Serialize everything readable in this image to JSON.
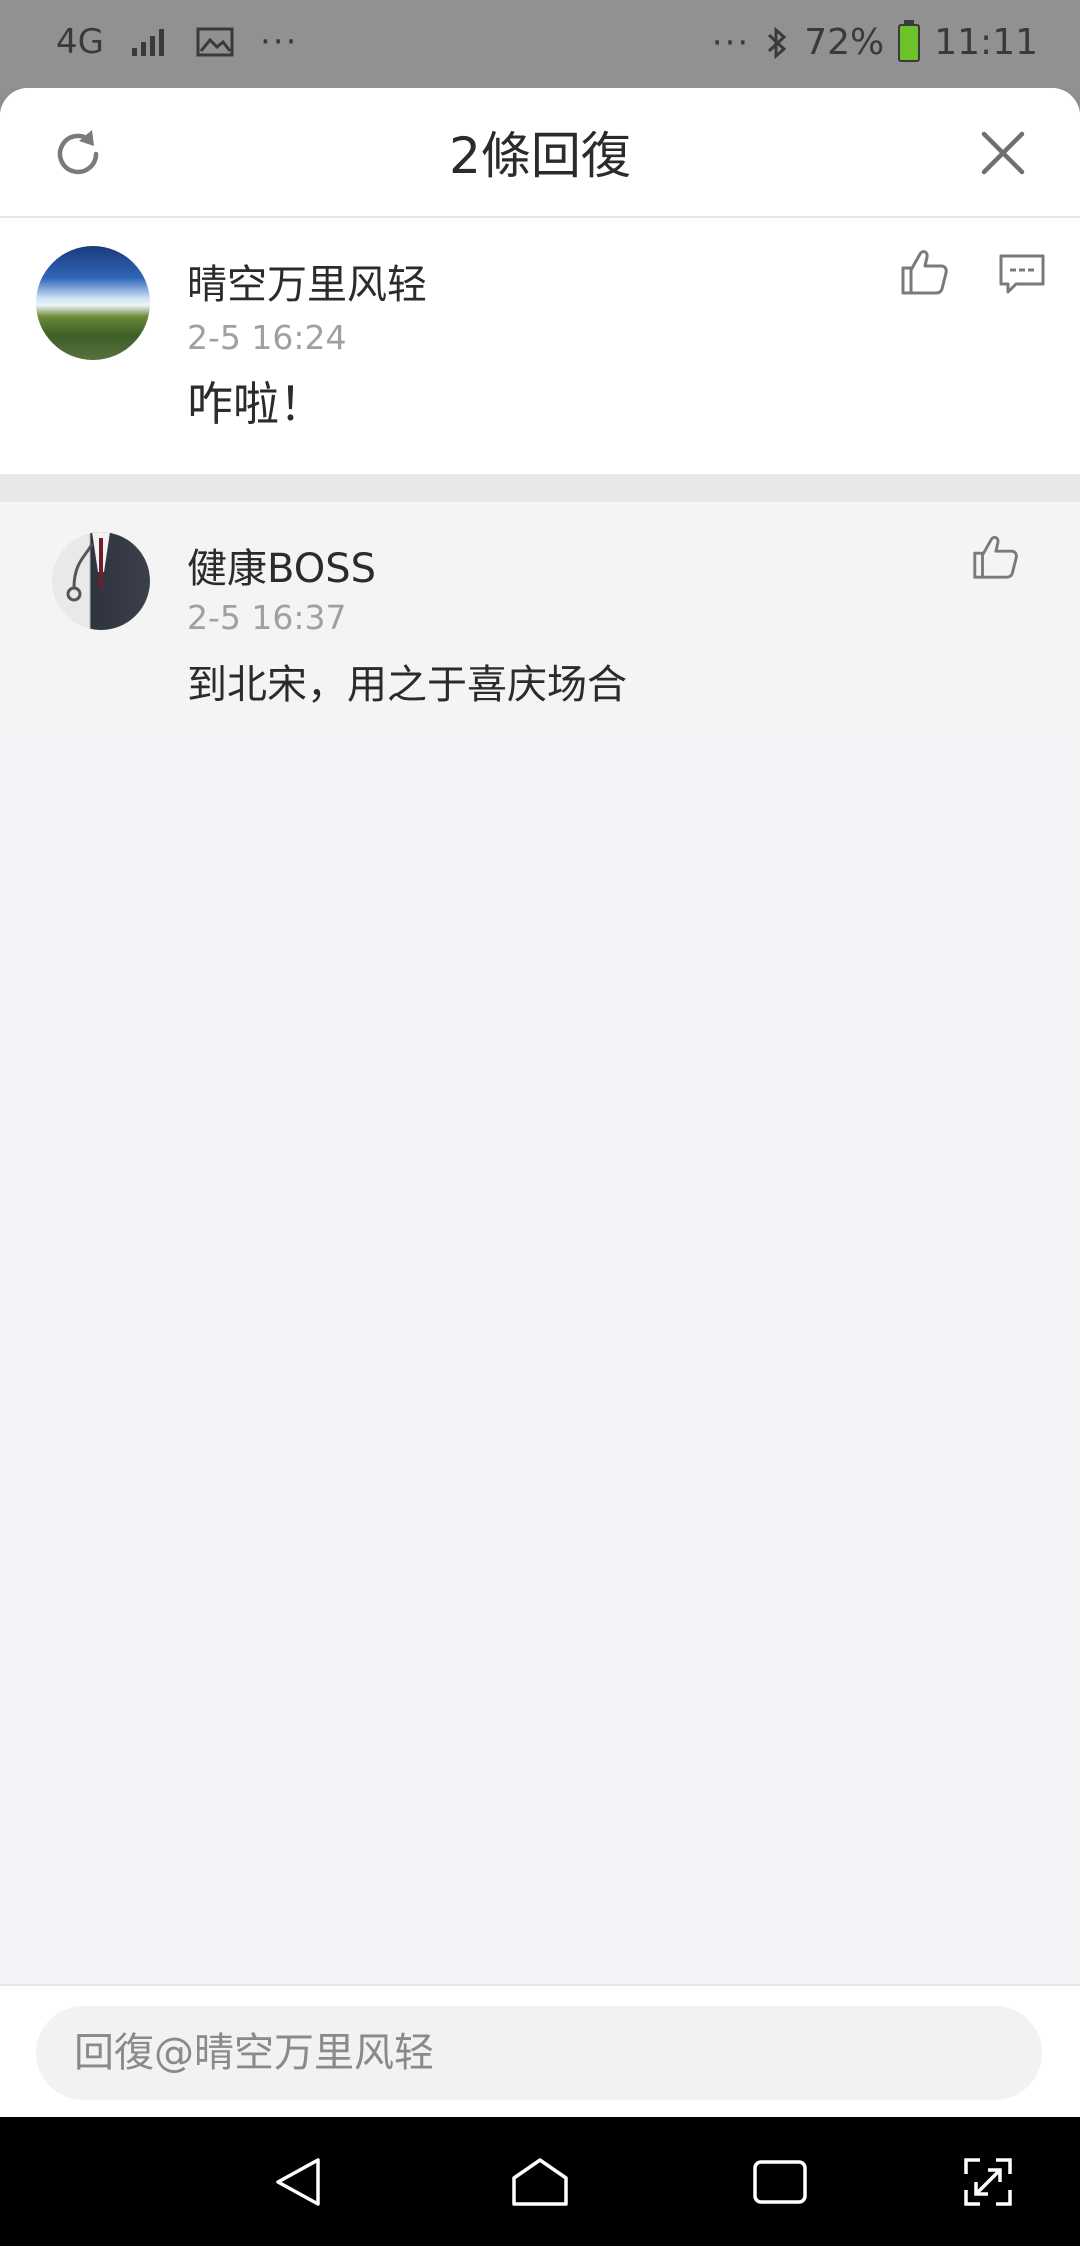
{
  "status_bar": {
    "network": "4G",
    "battery": "72%",
    "time": "11:11",
    "left_more": "···",
    "right_more": "···",
    "battery_color": "#6bc22a"
  },
  "header": {
    "title": "2條回復",
    "refresh_icon": "refresh-icon",
    "close_icon": "close-icon"
  },
  "main_comment": {
    "author": "晴空万里风轻",
    "time": "2-5 16:24",
    "text": "咋啦！",
    "like_icon": "thumbs-up-icon",
    "reply_icon": "comment-icon"
  },
  "replies": [
    {
      "author": "健康BOSS",
      "time": "2-5 16:37",
      "text": "到北宋，用之于喜庆场合",
      "like_icon": "thumbs-up-icon"
    }
  ],
  "input": {
    "placeholder": "回復@晴空万里风轻"
  },
  "nav": {
    "back_icon": "back-triangle-icon",
    "home_icon": "home-icon",
    "recents_icon": "recents-icon",
    "expand_icon": "expand-icon"
  }
}
